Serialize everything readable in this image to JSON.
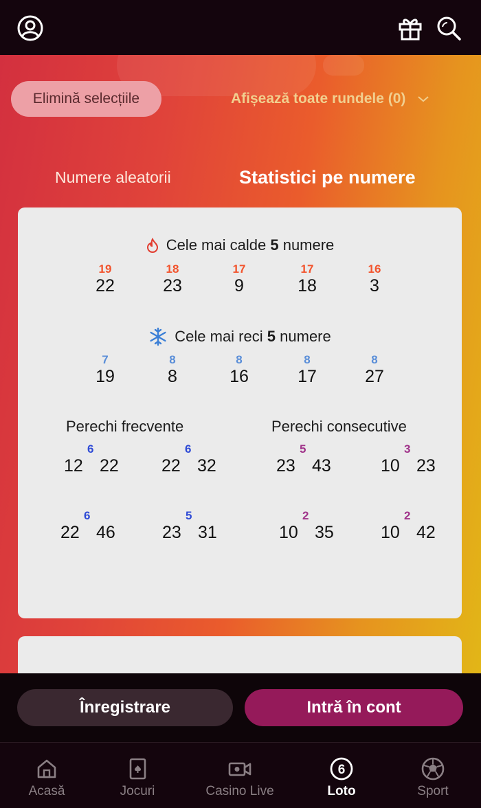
{
  "controls": {
    "clear_selections": "Elimină selecțiile",
    "show_rounds": "Afișează toate rundele (0)"
  },
  "tabs": {
    "random": "Numere aleatorii",
    "stats": "Statistici pe numere"
  },
  "hot": {
    "title_pre": "Cele mai calde",
    "title_count": "5",
    "title_post": "numere",
    "items": [
      {
        "count": "19",
        "value": "22"
      },
      {
        "count": "18",
        "value": "23"
      },
      {
        "count": "17",
        "value": "9"
      },
      {
        "count": "17",
        "value": "18"
      },
      {
        "count": "16",
        "value": "3"
      }
    ]
  },
  "cold": {
    "title_pre": "Cele mai reci",
    "title_count": "5",
    "title_post": "numere",
    "items": [
      {
        "count": "7",
        "value": "19"
      },
      {
        "count": "8",
        "value": "8"
      },
      {
        "count": "8",
        "value": "16"
      },
      {
        "count": "8",
        "value": "17"
      },
      {
        "count": "8",
        "value": "27"
      }
    ]
  },
  "frequent_pairs": {
    "title": "Perechi frecvente",
    "items": [
      {
        "a": "12",
        "b": "22",
        "count": "6"
      },
      {
        "a": "22",
        "b": "32",
        "count": "6"
      },
      {
        "a": "22",
        "b": "46",
        "count": "6"
      },
      {
        "a": "23",
        "b": "31",
        "count": "5"
      }
    ]
  },
  "consecutive_pairs": {
    "title": "Perechi consecutive",
    "items": [
      {
        "a": "23",
        "b": "43",
        "count": "5"
      },
      {
        "a": "10",
        "b": "23",
        "count": "3"
      },
      {
        "a": "10",
        "b": "35",
        "count": "2"
      },
      {
        "a": "10",
        "b": "42",
        "count": "2"
      }
    ]
  },
  "actions": {
    "register": "Înregistrare",
    "login": "Intră în cont"
  },
  "nav": {
    "items": [
      {
        "label": "Acasă",
        "icon": "home-icon"
      },
      {
        "label": "Jocuri",
        "icon": "cards-icon"
      },
      {
        "label": "Casino Live",
        "icon": "video-camera-icon"
      },
      {
        "label": "Loto",
        "icon": "lotto-ball-icon"
      },
      {
        "label": "Sport",
        "icon": "soccer-ball-icon"
      }
    ],
    "active": "Loto"
  },
  "colors": {
    "accent": "#951a5a",
    "hot_count": "#f2542d",
    "cold_count": "#5a8ed8",
    "frequent_count": "#2f4bd6",
    "consecutive_count": "#a0338a"
  }
}
